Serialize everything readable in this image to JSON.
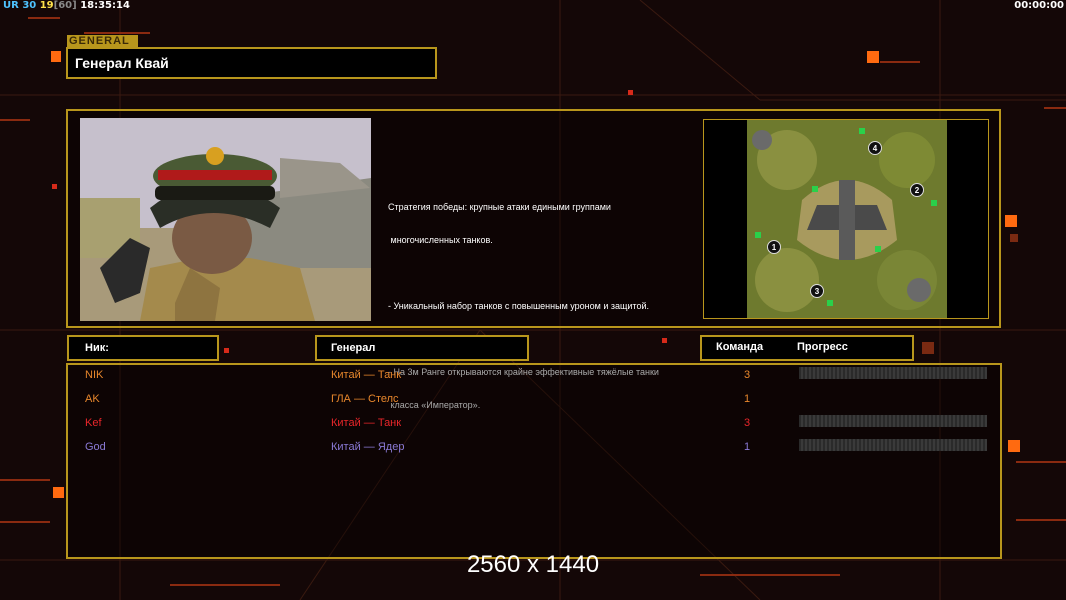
{
  "hud": {
    "left_parts": [
      {
        "text": "UR",
        "color": "#4fc3ff"
      },
      {
        "text": "30",
        "color": "#4fc3ff"
      },
      {
        "text": "19",
        "color": "#ffe14a"
      },
      {
        "text": "[60]",
        "color": "#8a8a8a"
      },
      {
        "text": "18:35:14",
        "color": "#ffffff"
      }
    ],
    "right_timer": "00:00:00"
  },
  "general": {
    "tab_label": "GENERAL",
    "name": "Генерал Квай",
    "description": [
      "Стратегия победы: крупные атаки едиными группами",
      " многочисленных танков.",
      "",
      "- Уникальный набор танков с повышенным уроном и защитой.",
      "",
      "- На 3м Ранге открываются крайне эффективные тяжёлые танки",
      " класса «Император»."
    ]
  },
  "minimap": {
    "markers": [
      "1",
      "2",
      "3",
      "4"
    ]
  },
  "table": {
    "headers": {
      "nick": "Ник:",
      "general": "Генерал",
      "team": "Команда",
      "progress": "Прогресс"
    },
    "rows": [
      {
        "nick": "NIK",
        "general": "Китай — Танк",
        "team": "3",
        "color": "#e8872c",
        "progress": 0
      },
      {
        "nick": "AK",
        "general": "ГЛА — Стелс",
        "team": "1",
        "color": "#e8872c",
        "progress": 0
      },
      {
        "nick": "Kef",
        "general": "Китай — Танк",
        "team": "3",
        "color": "#e8262a",
        "progress": 0
      },
      {
        "nick": "God",
        "general": "Китай — Ядер",
        "team": "1",
        "color": "#8a7ad6",
        "progress": 0
      }
    ]
  },
  "resolution_label": "2560 x 1440",
  "colors": {
    "frame": "#b8961c",
    "accent": "#ff6a10",
    "background": "#140707"
  }
}
